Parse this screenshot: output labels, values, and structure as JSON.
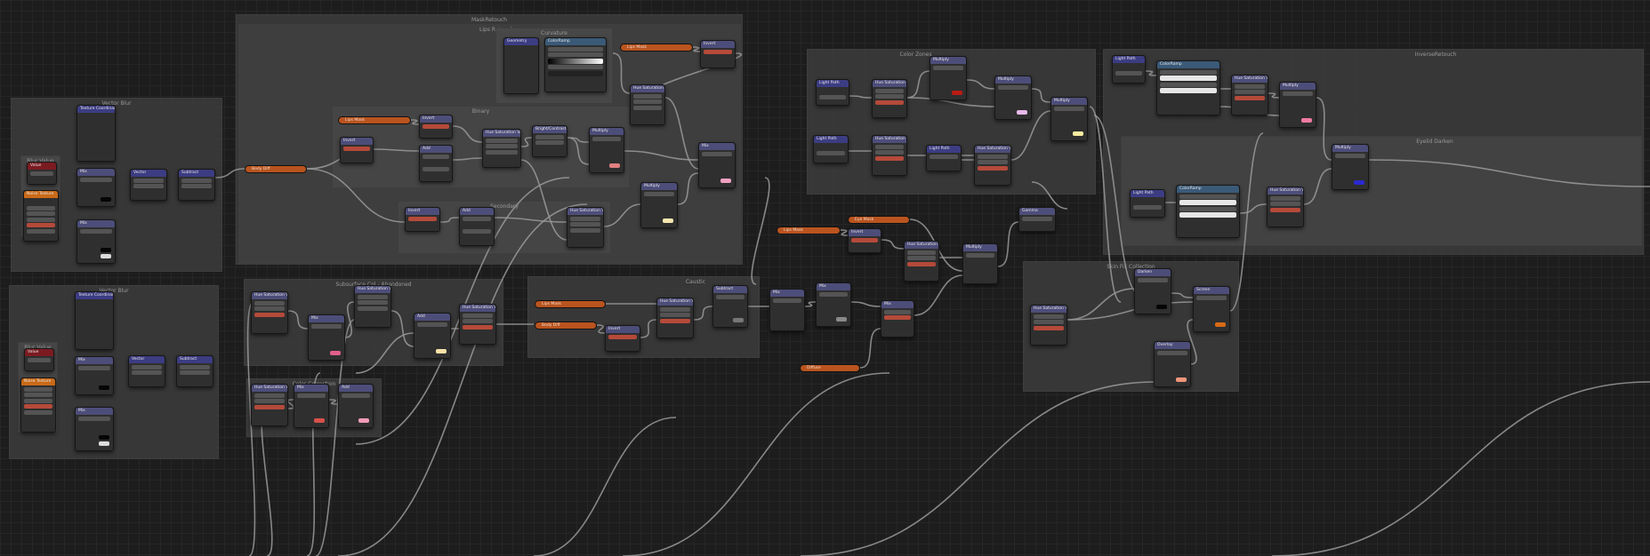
{
  "frames": {
    "mask_ret": "MaskRetouch",
    "lips": "Lips Retouch",
    "vector_blur_1": "Vector Blur",
    "vector_blur_2": "Vector Blur",
    "binary": "Binary",
    "secondary": "Secondary",
    "subsurface": "Subsurface Col - Abandoned",
    "color_correction": "Color Correction",
    "caustic": "Caustic",
    "color_zones": "Color Zones",
    "inverse_ret": "InverseRetouch",
    "eyelid": "Eyelid Darken",
    "skin": "Skin Fix Collection"
  },
  "nodes": {
    "curvature": "Curvature",
    "geometry": "Geometry",
    "blur_value_1": "Blur Value",
    "blur_value_2": "Blur Value",
    "invert": "Invert",
    "hsv": "Hue Saturation Value",
    "multiply": "Multiply",
    "mix": "Mix",
    "add": "Add",
    "brightcontrast": "Bright/Contrast",
    "gamma": "Gamma",
    "colorramp": "ColorRamp",
    "screen": "Screen",
    "overlay": "Overlay",
    "darken": "Darken",
    "subtract": "Subtract",
    "texture": "Texture Coordinate",
    "vector_math": "Vector",
    "noise": "Noise Texture",
    "value": "Value",
    "light_path": "Light Path",
    "separate": "Separate",
    "math": "Math"
  },
  "reroutes": {
    "lips_mask_1": "Lips Mask",
    "lips_mask_2": "Lips Mask",
    "lips_mask_3": "Lips Mask",
    "lips_mask_4": "Lips Mask",
    "body_diff_1": "Body Diff",
    "body_diff_2": "Body Diff",
    "eye_mask": "Eye Mask",
    "ao": "AO",
    "diffuse": "Diffuse"
  },
  "colors": {
    "background": "#1d1d1d",
    "frame": "#3a3a3a",
    "node_body": "#2f2f2f",
    "reroute": "#b9541f",
    "socket": "#c7c729",
    "wire": "#9a9a9a"
  }
}
